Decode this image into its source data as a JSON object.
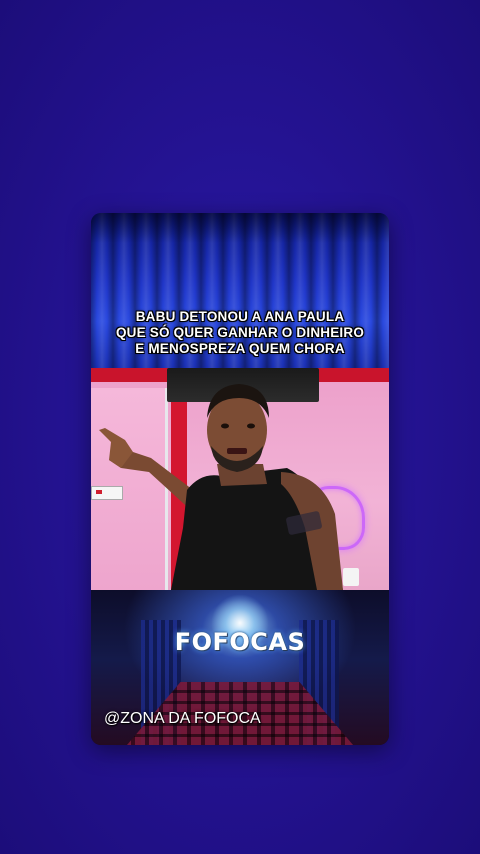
{
  "headline": {
    "line1": "BABU DETONOU A ANA PAULA",
    "line2": "QUE SÓ QUER GANHAR O DINHEIRO",
    "line3": "E MENOSPREZA QUEM CHORA"
  },
  "overlay": {
    "logo_text": "FOFOCAS",
    "handle": "@ZONA DA FOFOCA"
  },
  "colors": {
    "background": "#23128f",
    "curtain": "#1f35c8",
    "wall": "#f2b3d6",
    "accent_red": "#c9142c"
  }
}
